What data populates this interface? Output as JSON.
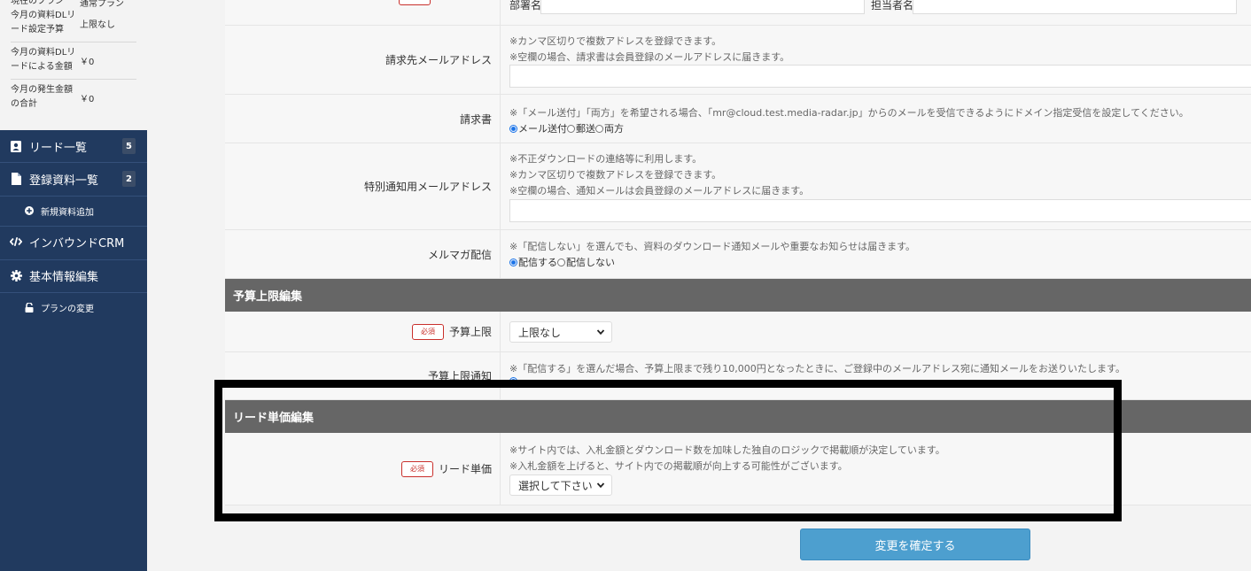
{
  "sidebar": {
    "stats": [
      {
        "label_line1": "今月の資料DLリ",
        "label_line2": "ード設定予算",
        "value": "上限なし"
      },
      {
        "label_line1": "今月の資料DLリ",
        "label_line2": "ードによる金額",
        "value": "￥0"
      },
      {
        "label_line1": "今月の発生金額",
        "label_line2": "の合計",
        "value": "￥0"
      }
    ],
    "top_partial_label": "現在のプラン",
    "top_partial_value": "通常プラン",
    "nav": {
      "leads": {
        "label": "リード一覧",
        "badge": "5"
      },
      "materials": {
        "label": "登録資料一覧",
        "badge": "2"
      },
      "add_material": {
        "label": "新規資料追加"
      },
      "inbound_crm": {
        "label": "インバウンドCRM"
      },
      "basic_info": {
        "label": "基本情報編集"
      },
      "plan_change": {
        "label": "プランの変更"
      }
    }
  },
  "form": {
    "dept_label": "部署名",
    "person_label": "担当者名",
    "billing_email": {
      "label": "請求先メールアドレス",
      "notes": [
        "※カンマ区切りで複数アドレスを登録できます。",
        "※空欄の場合、請求書は会員登録のメールアドレスに届きます。"
      ]
    },
    "invoice": {
      "label": "請求書",
      "note": "※「メール送付」「両方」を希望される場合、「mr@cloud.test.media-radar.jp」からのメールを受信できるようにドメイン指定受信を設定してください。",
      "options": [
        "メール送付",
        "郵送",
        "両方"
      ]
    },
    "special_email": {
      "label": "特別通知用メールアドレス",
      "notes": [
        "※不正ダウンロードの連絡等に利用します。",
        "※カンマ区切りで複数アドレスを登録できます。",
        "※空欄の場合、通知メールは会員登録のメールアドレスに届きます。"
      ]
    },
    "newsletter": {
      "label": "メルマガ配信",
      "note": "※「配信しない」を選んでも、資料のダウンロード通知メールや重要なお知らせは届きます。",
      "options": [
        "配信する",
        "配信しない"
      ]
    },
    "budget_section": {
      "title": "予算上限編集"
    },
    "budget_limit": {
      "required": "必須",
      "label": "予算上限",
      "selected": "上限なし"
    },
    "budget_notice": {
      "label": "予算上限通知",
      "note": "※「配信する」を選んだ場合、予算上限まで残り10,000円となったときに、ご登録中のメールアドレス宛に通知メールをお送りいたします。"
    },
    "lead_section": {
      "title": "リード単価編集"
    },
    "lead_price": {
      "required": "必須",
      "label": "リード単価",
      "notes": [
        "※サイト内では、入札金額とダウンロード数を加味した独自のロジックで掲載順が決定しています。",
        "※入札金額を上げると、サイト内での掲載順が向上する可能性がございます。"
      ],
      "selected": "選択して下さい"
    },
    "submit_label": "変更を確定する"
  },
  "colors": {
    "sidebar_bg": "#213a5f",
    "section_header_bg": "#666666",
    "button_bg": "#4d9fcf",
    "required_red": "#c9302c"
  }
}
